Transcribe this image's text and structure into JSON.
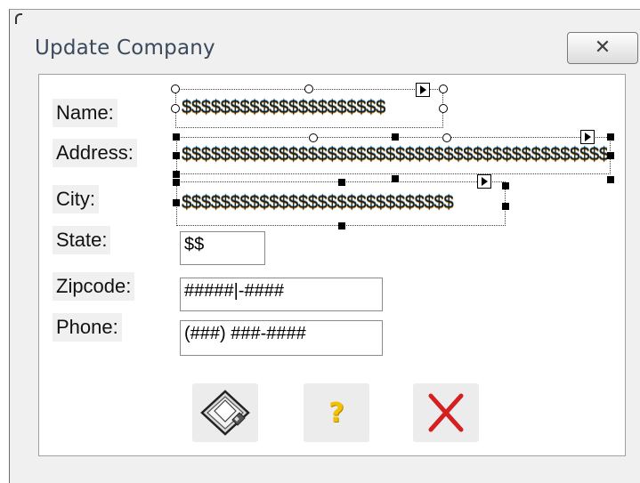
{
  "window": {
    "title": "Update Company",
    "close_glyph": "✕"
  },
  "labels": {
    "name": "Name:",
    "address": "Address:",
    "city": "City:",
    "state": "State:",
    "zipcode": "Zipcode:",
    "phone": "Phone:"
  },
  "fields": {
    "name": "$$$$$$$$$$$$$$$$$$$$$",
    "address": "$$$$$$$$$$$$$$$$$$$$$$$$$$$$$$$$$$$$$$$$$$$$",
    "city": "$$$$$$$$$$$$$$$$$$$$$$$$$$$$",
    "state": "$$",
    "zipcode": "#####|-####",
    "phone": "(###) ###-####"
  },
  "buttons": {
    "save": "floppy-disk-icon",
    "help": "?",
    "cancel": "red-x-icon"
  },
  "colors": {
    "window_bg": "#f0f0f0",
    "title_text": "#3a4a5c",
    "help_yellow": "#f2c200",
    "cancel_red": "#d42020"
  }
}
